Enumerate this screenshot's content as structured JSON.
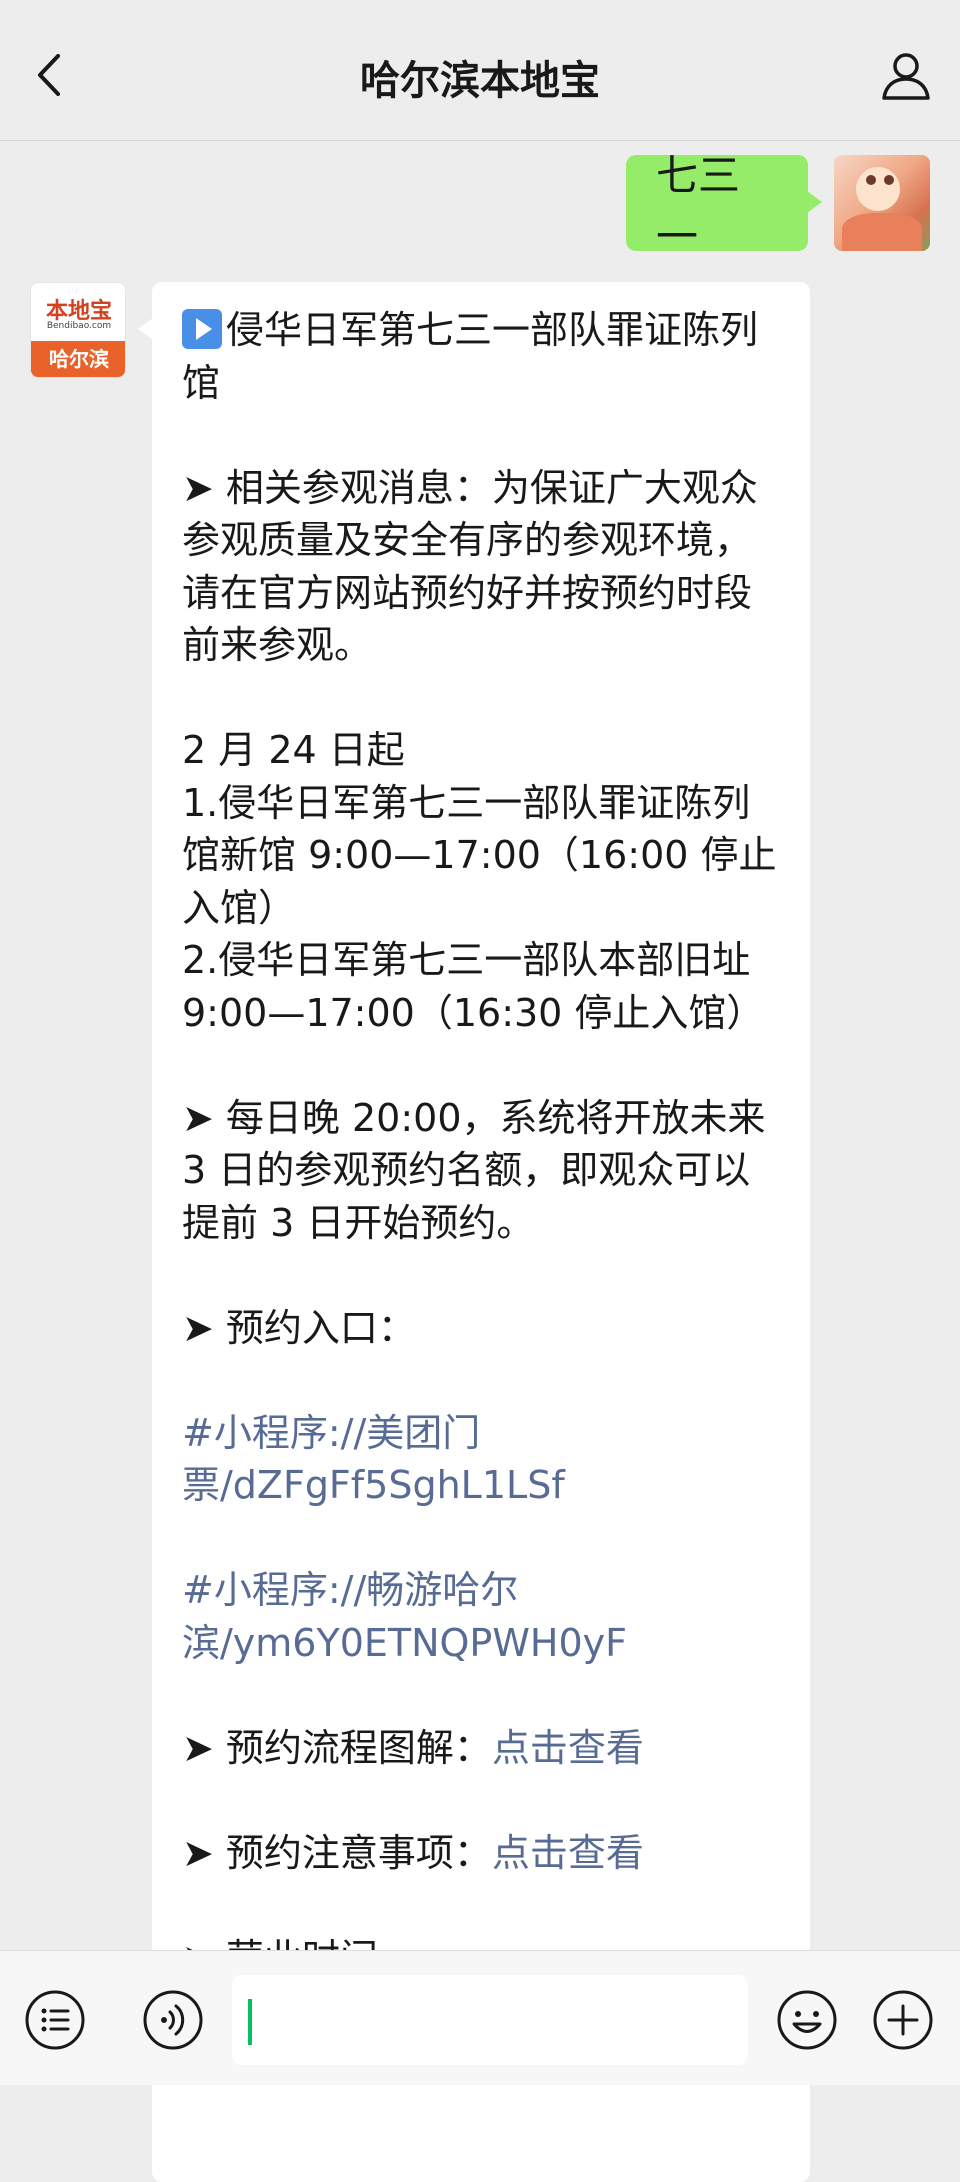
{
  "header": {
    "title": "哈尔滨本地宝",
    "back_icon": "chevron-left-icon",
    "profile_icon": "person-icon"
  },
  "my_message": {
    "text": "七三一"
  },
  "bot_avatar": {
    "brand": "本地宝",
    "url": "Bendibao.com",
    "city": "哈尔滨"
  },
  "bot_message": {
    "title": "侵华日军第七三一部队罪证陈列馆",
    "notice": "➤ 相关参观消息：为保证广大观众参观质量及安全有序的参观环境，请在官方网站预约好并按预约时段前来参观。",
    "since": "2 月 24 日起",
    "item1": "1.侵华日军第七三一部队罪证陈列馆新馆 9:00—17:00（16:00 停止入馆）",
    "item2": "2.侵华日军第七三一部队本部旧址 9:00—17:00（16:30 停止入馆）",
    "booking_open": "➤ 每日晚 20:00，系统将开放未来 3 日的参观预约名额，即观众可以提前 3 日开始预约。",
    "entry_label": "➤ 预约入口：",
    "link1": "#小程序://美团门票/dZFgFf5SghL1LSf",
    "link2": "#小程序://畅游哈尔滨/ym6Y0ETNQPWH0yF",
    "flow_label": "➤ 预约流程图解：",
    "flow_link": "点击查看",
    "notes_label": "➤ 预约注意事项：",
    "notes_link": "点击查看",
    "cut_off": "➤ 营业时间"
  },
  "input_bar": {
    "menu_icon": "menu-list-icon",
    "voice_icon": "voice-icon",
    "input_value": "",
    "emoji_icon": "emoji-icon",
    "plus_icon": "plus-icon"
  },
  "colors": {
    "my_bubble": "#95ec69",
    "link": "#576b95",
    "cursor": "#07c160"
  }
}
